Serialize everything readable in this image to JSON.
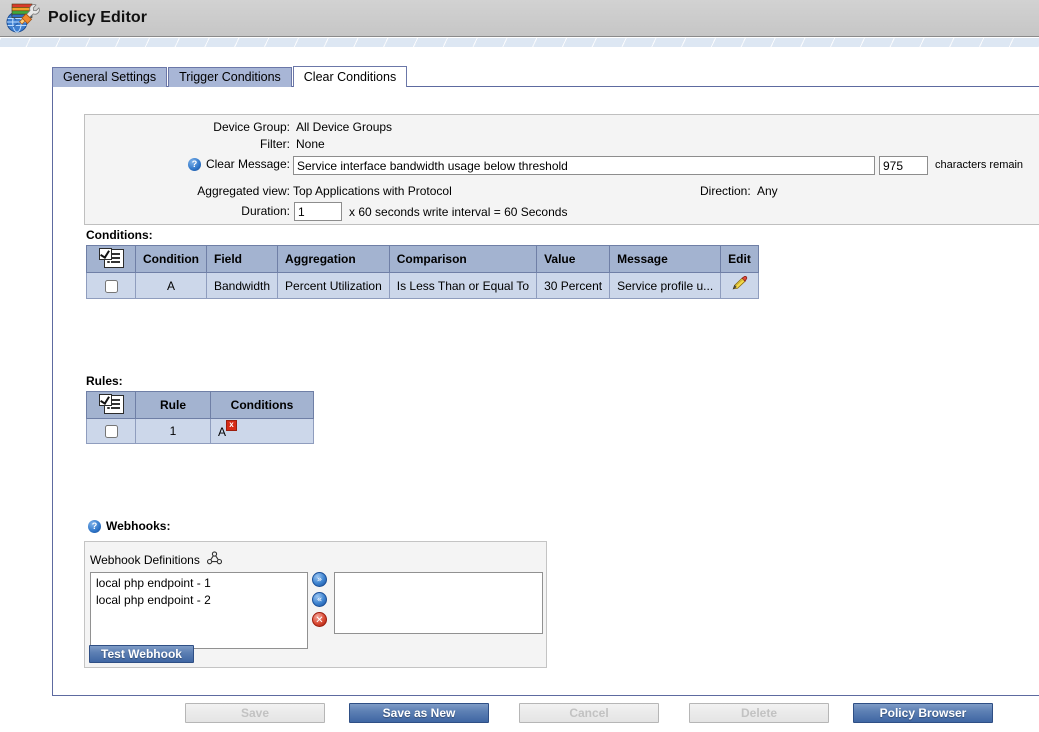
{
  "window": {
    "title": "Policy Editor",
    "app_icon": "policy-editor-icon"
  },
  "tabs": [
    {
      "label": "General Settings",
      "active": false
    },
    {
      "label": "Trigger Conditions",
      "active": false
    },
    {
      "label": "Clear Conditions",
      "active": true
    }
  ],
  "summary": {
    "device_group_label": "Device Group:",
    "device_group_value": "All Device Groups",
    "filter_label": "Filter:",
    "filter_value": "None",
    "clear_message_label": "Clear Message:",
    "clear_message_value": "Service interface bandwidth usage below threshold",
    "chars_remain_value": "975",
    "chars_remain_label": "characters remain",
    "aggregated_view_label": "Aggregated view:",
    "aggregated_view_value": "Top Applications with Protocol",
    "direction_label": "Direction:",
    "direction_value": "Any",
    "duration_label": "Duration:",
    "duration_value": "1",
    "duration_suffix": "x 60 seconds write interval = 60 Seconds",
    "help_icon": "?"
  },
  "conditions": {
    "caption": "Conditions:",
    "columns": [
      "",
      "Condition",
      "Field",
      "Aggregation",
      "Comparison",
      "Value",
      "Message",
      "Edit"
    ],
    "rows": [
      {
        "checked": false,
        "condition": "A",
        "field": "Bandwidth",
        "aggregation": "Percent Utilization",
        "comparison": "Is Less Than or Equal To",
        "value": "30 Percent",
        "message": "Service profile u...",
        "edit_icon": "pencil-icon"
      }
    ]
  },
  "rules": {
    "caption": "Rules:",
    "columns": [
      "",
      "Rule",
      "Conditions"
    ],
    "rows": [
      {
        "checked": false,
        "rule": "1",
        "conditions": "A",
        "delete_badge": "x"
      }
    ]
  },
  "webhooks": {
    "caption": "Webhooks:",
    "help_icon": "?",
    "definitions_label": "Webhook Definitions",
    "definitions_icon": "network-nodes-icon",
    "available": [
      "local php endpoint - 1",
      "local php endpoint - 2"
    ],
    "selected": [],
    "move_right_icon": "»",
    "move_left_icon": "«",
    "remove_icon": "✕",
    "test_button_label": "Test Webhook"
  },
  "footer": {
    "buttons": [
      {
        "label": "Save",
        "enabled": false
      },
      {
        "label": "Save as New",
        "enabled": true
      },
      {
        "label": "Cancel",
        "enabled": false
      },
      {
        "label": "Delete",
        "enabled": false
      },
      {
        "label": "Policy Browser",
        "enabled": true
      }
    ]
  },
  "colors": {
    "titlebar": "#cccccc",
    "strip": "#dde7f3",
    "tab_inactive": "#a8b6d6",
    "panel_border": "#5d6aa0",
    "grid_header": "#a3b3d0",
    "grid_row": "#ccd7ea",
    "button_blue": "#4a70ad",
    "accent_red": "#d62b16",
    "help_blue": "#2e75c8"
  }
}
